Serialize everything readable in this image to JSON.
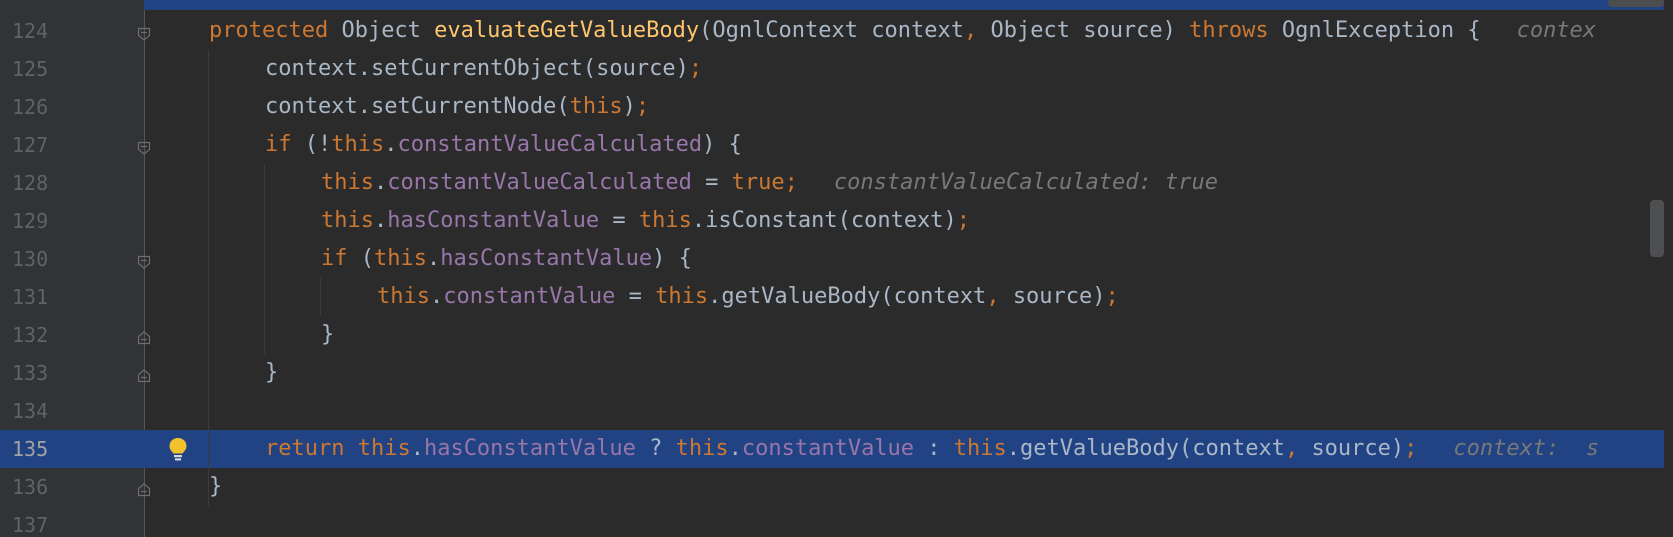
{
  "editor": {
    "lines": [
      {
        "number": "124",
        "indent": 0,
        "fold": "open",
        "tokens": [
          {
            "t": "protected ",
            "c": "kw"
          },
          {
            "t": "Object ",
            "c": "plain"
          },
          {
            "t": "evaluateGetValueBody",
            "c": "fn"
          },
          {
            "t": "(OgnlContext context",
            "c": "plain"
          },
          {
            "t": ", ",
            "c": "kw"
          },
          {
            "t": "Object source) ",
            "c": "plain"
          },
          {
            "t": "throws ",
            "c": "kw"
          },
          {
            "t": "OgnlException {",
            "c": "plain"
          }
        ],
        "hint": "contex"
      },
      {
        "number": "125",
        "indent": 1,
        "tokens": [
          {
            "t": "context.setCurrentObject(source)",
            "c": "plain"
          },
          {
            "t": ";",
            "c": "kw"
          }
        ]
      },
      {
        "number": "126",
        "indent": 1,
        "tokens": [
          {
            "t": "context.setCurrentNode(",
            "c": "plain"
          },
          {
            "t": "this",
            "c": "kw"
          },
          {
            "t": ")",
            "c": "plain"
          },
          {
            "t": ";",
            "c": "kw"
          }
        ]
      },
      {
        "number": "127",
        "indent": 1,
        "fold": "open",
        "tokens": [
          {
            "t": "if ",
            "c": "kw"
          },
          {
            "t": "(!",
            "c": "plain"
          },
          {
            "t": "this",
            "c": "kw"
          },
          {
            "t": ".",
            "c": "plain"
          },
          {
            "t": "constantValueCalculated",
            "c": "fld"
          },
          {
            "t": ") {",
            "c": "plain"
          }
        ]
      },
      {
        "number": "128",
        "indent": 2,
        "tokens": [
          {
            "t": "this",
            "c": "kw"
          },
          {
            "t": ".",
            "c": "plain"
          },
          {
            "t": "constantValueCalculated",
            "c": "fld"
          },
          {
            "t": " = ",
            "c": "plain"
          },
          {
            "t": "true",
            "c": "kw"
          },
          {
            "t": ";",
            "c": "kw"
          }
        ],
        "hint": "constantValueCalculated: true"
      },
      {
        "number": "129",
        "indent": 2,
        "tokens": [
          {
            "t": "this",
            "c": "kw"
          },
          {
            "t": ".",
            "c": "plain"
          },
          {
            "t": "hasConstantValue",
            "c": "fld"
          },
          {
            "t": " = ",
            "c": "plain"
          },
          {
            "t": "this",
            "c": "kw"
          },
          {
            "t": ".isConstant(context)",
            "c": "plain"
          },
          {
            "t": ";",
            "c": "kw"
          }
        ]
      },
      {
        "number": "130",
        "indent": 2,
        "fold": "open",
        "tokens": [
          {
            "t": "if ",
            "c": "kw"
          },
          {
            "t": "(",
            "c": "plain"
          },
          {
            "t": "this",
            "c": "kw"
          },
          {
            "t": ".",
            "c": "plain"
          },
          {
            "t": "hasConstantValue",
            "c": "fld"
          },
          {
            "t": ") {",
            "c": "plain"
          }
        ]
      },
      {
        "number": "131",
        "indent": 3,
        "tokens": [
          {
            "t": "this",
            "c": "kw"
          },
          {
            "t": ".",
            "c": "plain"
          },
          {
            "t": "constantValue",
            "c": "fld"
          },
          {
            "t": " = ",
            "c": "plain"
          },
          {
            "t": "this",
            "c": "kw"
          },
          {
            "t": ".getValueBody(context",
            "c": "plain"
          },
          {
            "t": ", ",
            "c": "kw"
          },
          {
            "t": "source)",
            "c": "plain"
          },
          {
            "t": ";",
            "c": "kw"
          }
        ]
      },
      {
        "number": "132",
        "indent": 2,
        "fold": "close",
        "tokens": [
          {
            "t": "}",
            "c": "plain"
          }
        ]
      },
      {
        "number": "133",
        "indent": 1,
        "fold": "close",
        "tokens": [
          {
            "t": "}",
            "c": "plain"
          }
        ]
      },
      {
        "number": "134",
        "indent": 0,
        "tokens": []
      },
      {
        "number": "135",
        "indent": 1,
        "current": true,
        "bulb": true,
        "tokens": [
          {
            "t": "return ",
            "c": "kw"
          },
          {
            "t": "this",
            "c": "kw"
          },
          {
            "t": ".",
            "c": "plain"
          },
          {
            "t": "hasConstantValue",
            "c": "fld"
          },
          {
            "t": " ? ",
            "c": "plain"
          },
          {
            "t": "this",
            "c": "kw"
          },
          {
            "t": ".",
            "c": "plain"
          },
          {
            "t": "constantValue",
            "c": "fld"
          },
          {
            "t": " : ",
            "c": "plain"
          },
          {
            "t": "this",
            "c": "kw"
          },
          {
            "t": ".getValueBody(context",
            "c": "plain"
          },
          {
            "t": ", ",
            "c": "kw"
          },
          {
            "t": "source)",
            "c": "plain"
          },
          {
            "t": ";",
            "c": "kw"
          }
        ],
        "hint": "context:  s"
      },
      {
        "number": "136",
        "indent": 0,
        "fold": "close",
        "tokens": [
          {
            "t": "}",
            "c": "plain"
          }
        ]
      },
      {
        "number": "137",
        "indent": 0,
        "tokens": []
      }
    ],
    "icons": {
      "fold_open": "fold-open-icon",
      "fold_close": "fold-close-icon",
      "intention": "lightbulb-icon"
    },
    "colors": {
      "background": "#2b2b2b",
      "gutter": "#313335",
      "current_line": "#214283",
      "keyword": "#cc7832",
      "method": "#ffc66d",
      "field": "#9876aa",
      "text": "#a9b7c6",
      "hint": "#787878",
      "line_number": "#606366"
    }
  }
}
